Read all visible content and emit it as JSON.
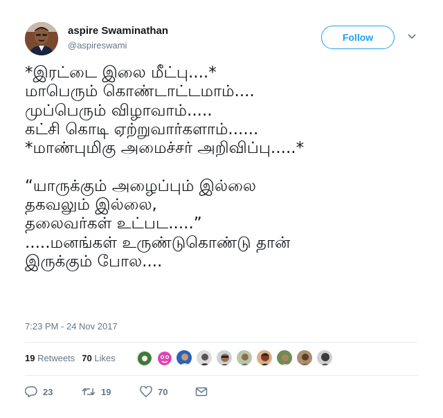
{
  "user": {
    "name": "aspire Swaminathan",
    "handle": "@aspireswami",
    "follow_label": "Follow"
  },
  "tweet": {
    "lines": [
      "*இரட்டை இலை மீட்பு....*",
      "மாபெரும் கொண்டாட்டமாம்....",
      "முப்பெரும் விழாவாம்.....",
      "கட்சி கொடி ஏற்றுவார்களாம்......",
      "*மாண்புமிகு அமைச்சர் அறிவிப்பு.....*",
      "",
      "“யாருக்கும் அழைப்பும் இல்லை",
      "தகவலும் இல்லை,",
      "தலைவர்கள் உட்பட.....”",
      ".....மனங்கள் உருண்டுகொண்டு தான்",
      "இருக்கும் போல...."
    ],
    "timestamp": "7:23 PM - 24 Nov 2017"
  },
  "stats": {
    "retweets_count": "19",
    "retweets_label": "Retweets",
    "likes_count": "70",
    "likes_label": "Likes"
  },
  "actions": {
    "reply_count": "23",
    "retweet_count": "19",
    "like_count": "70"
  },
  "colors": {
    "accent": "#1da1f2",
    "muted": "#657786",
    "text": "#14171a",
    "divider": "#e6ecf0"
  }
}
